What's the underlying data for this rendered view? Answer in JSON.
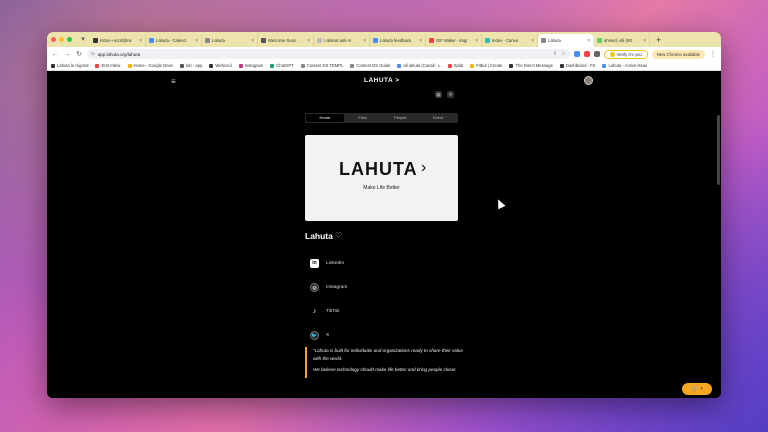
{
  "browser": {
    "tabs": [
      {
        "label": "Inbox • scott@rw",
        "color": "#333"
      },
      {
        "label": "Lahuta - Calend",
        "color": "#4a8df6"
      },
      {
        "label": "Lahuta",
        "color": "#888"
      },
      {
        "label": "Welcome Sunn",
        "color": "#555"
      },
      {
        "label": "I almost ask AI",
        "color": "#bbb"
      },
      {
        "label": "Lahuta feedback",
        "color": "#4a8df6"
      },
      {
        "label": "GIF Maker - imgr",
        "color": "#e44"
      },
      {
        "label": "Index - Canva",
        "color": "#3bb"
      },
      {
        "label": "Lahuta",
        "color": "#888"
      },
      {
        "label": "ahmed, elli (8G",
        "color": "#6c6"
      }
    ],
    "active_tab": 8,
    "new_tab_glyph": "+",
    "url": "app.lahuta.org/lahuta",
    "verify_label": "Verify it's you",
    "update_label": "New Chrome available",
    "bookmarks": [
      {
        "label": "Lahuta le régond",
        "color": "#333"
      },
      {
        "label": "Entr Inbox",
        "color": "#e44"
      },
      {
        "label": "Home - Google Drive",
        "color": "#f4b400"
      },
      {
        "label": "Iob - app",
        "color": "#555"
      },
      {
        "label": "Webcool",
        "color": "#333"
      },
      {
        "label": "Instagram",
        "color": "#c13584"
      },
      {
        "label": "ChatGPT",
        "color": "#10a37f"
      },
      {
        "label": "Content DS TEMPL",
        "color": "#888"
      },
      {
        "label": "Content DS Guide",
        "color": "#888"
      },
      {
        "label": "all lahuta (Canall - L",
        "color": "#4a8df6"
      },
      {
        "label": "Splat",
        "color": "#e44"
      },
      {
        "label": "Fitbul | Create",
        "color": "#f4b400"
      },
      {
        "label": "The Direct Message",
        "color": "#333"
      },
      {
        "label": "Dashboard - FS",
        "color": "#333"
      },
      {
        "label": "Lahuta - Active Issue",
        "color": "#4a8df6"
      }
    ]
  },
  "page": {
    "site_title": "LAHUTA >",
    "menu_glyph": "≡",
    "nav_tabs": [
      "Home",
      "Files",
      "People",
      "Event"
    ],
    "active_nav": 0,
    "hero": {
      "title": "LAHUTA",
      "chevron": "›",
      "tagline": "Make Life Better"
    },
    "profile_name": "Lahuta",
    "heart_glyph": "♡",
    "links": [
      {
        "label": "LinkedIn",
        "glyph": "in",
        "style": "square"
      },
      {
        "label": "Instagram",
        "glyph": "◎",
        "style": "round"
      },
      {
        "label": "TikTok",
        "glyph": "♪",
        "style": "plain"
      },
      {
        "label": "X",
        "glyph": "🐦",
        "style": "round"
      }
    ],
    "quote": [
      "\"Lahuta is built for individuals and organizations ready to share their value with the world.",
      "We believe technology should make life better and bring people closer."
    ],
    "cart_glyph": "🛒 ›"
  }
}
